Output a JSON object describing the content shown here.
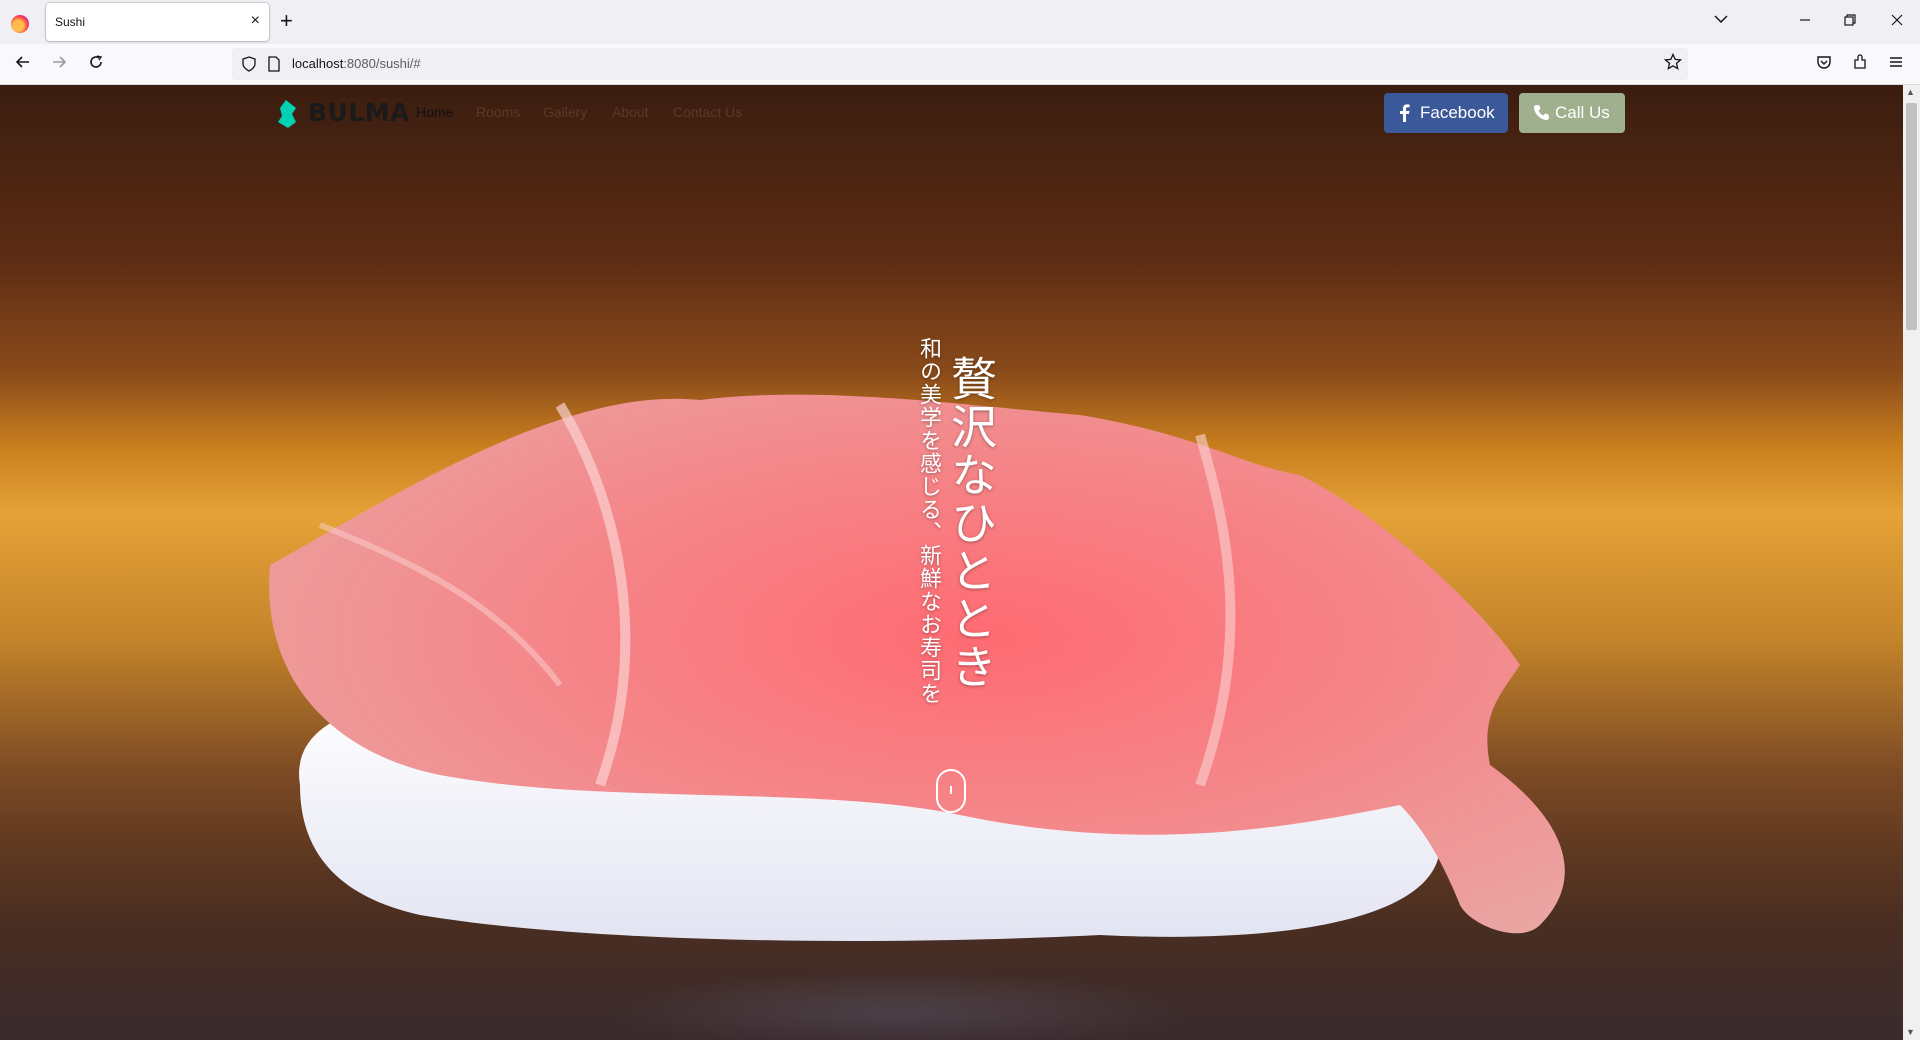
{
  "browser": {
    "tab_title": "Sushi",
    "tab_close": "×",
    "new_tab": "+",
    "url_host": "localhost",
    "url_path": ":8080/sushi/#"
  },
  "site": {
    "brand": "BULMA",
    "menu": [
      {
        "label": "Home",
        "active": true
      },
      {
        "label": "Rooms",
        "active": false
      },
      {
        "label": "Gallery",
        "active": false
      },
      {
        "label": "About",
        "active": false
      },
      {
        "label": "Contact Us",
        "active": false
      }
    ],
    "buttons": {
      "facebook": "Facebook",
      "call": "Call Us"
    },
    "hero": {
      "headline": "贅沢なひととき",
      "subline": "和の美学を感じる、新鮮なお寿司を"
    }
  },
  "colors": {
    "facebook": "#3b5998",
    "call": "#a0b08e",
    "brand_mark": "#00d1b2"
  }
}
